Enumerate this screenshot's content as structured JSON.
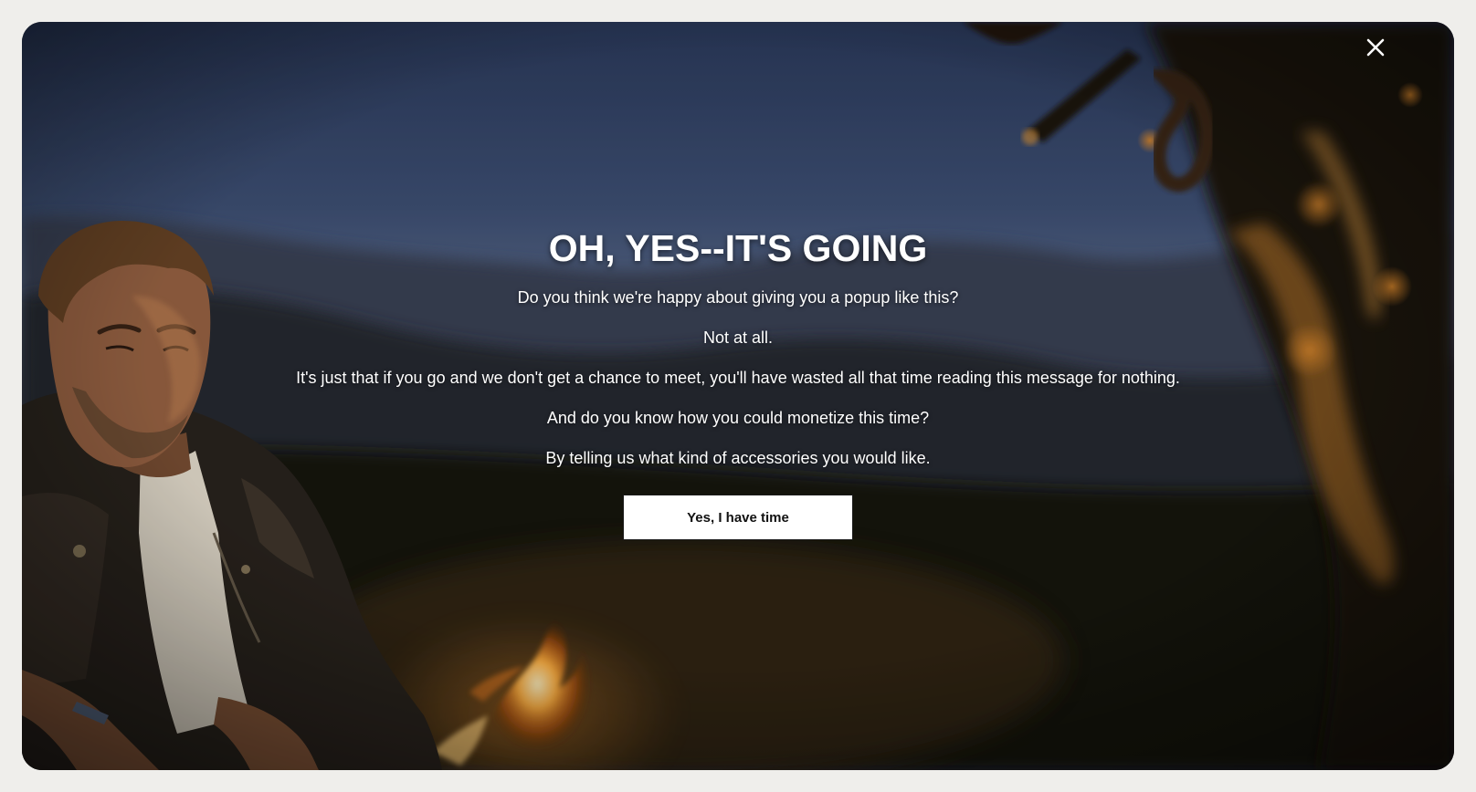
{
  "popup": {
    "title": "OH, YES--IT'S GOING",
    "messages": [
      "Do you think we're happy about giving you a popup like this?",
      "Not at all.",
      "It's just that if you go and we don't get a chance to meet, you'll have wasted all that time reading this message for nothing.",
      "And do you know how you could monetize this time?",
      "By telling us what kind of accessories you would like."
    ],
    "cta_label": "Yes, I have time",
    "close_icon": "close-icon",
    "background_image": "man-by-campfire-at-dusk",
    "colors": {
      "text": "#ffffff",
      "button_bg": "#ffffff",
      "button_text": "#111111",
      "page_bg": "#efeeeb"
    }
  }
}
